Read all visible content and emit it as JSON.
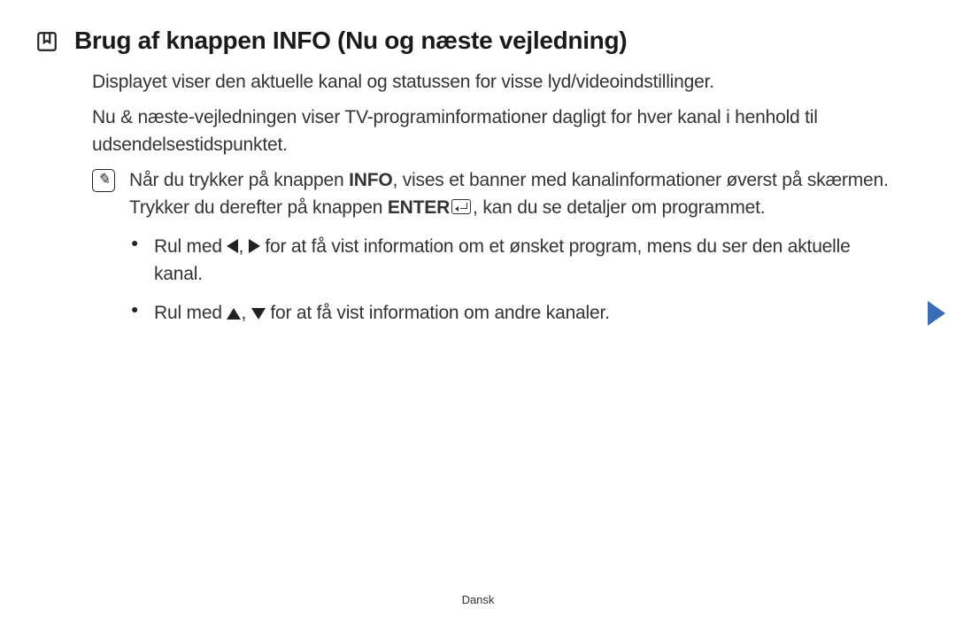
{
  "header": {
    "title": "Brug af knappen INFO (Nu og næste vejledning)"
  },
  "paragraphs": {
    "p1": "Displayet viser den aktuelle kanal og statussen for visse lyd/videoindstillinger.",
    "p2": "Nu & næste-vejledningen viser TV-programinformationer dagligt for hver kanal i henhold til udsendelsestidspunktet."
  },
  "note": {
    "pre": "Når du trykker på knappen ",
    "bold1": "INFO",
    "mid": ", vises et banner med kanalinformationer øverst på skærmen. Trykker du derefter på knappen ",
    "bold2": "ENTER",
    "post": ", kan du se detaljer om programmet."
  },
  "bullets": {
    "b1_pre": "Rul med ",
    "b1_post": " for at få vist information om et ønsket program, mens du ser den aktuelle kanal.",
    "b2_pre": "Rul med ",
    "b2_post": " for at få vist information om andre kanaler."
  },
  "footer": {
    "language": "Dansk"
  },
  "icons": {
    "section": "bookmark-icon",
    "note": "pencil-note-icon",
    "enter": "enter-key-icon",
    "left": "arrow-left-icon",
    "right": "arrow-right-icon",
    "up": "arrow-up-icon",
    "down": "arrow-down-icon",
    "nav_next": "page-next-icon"
  }
}
